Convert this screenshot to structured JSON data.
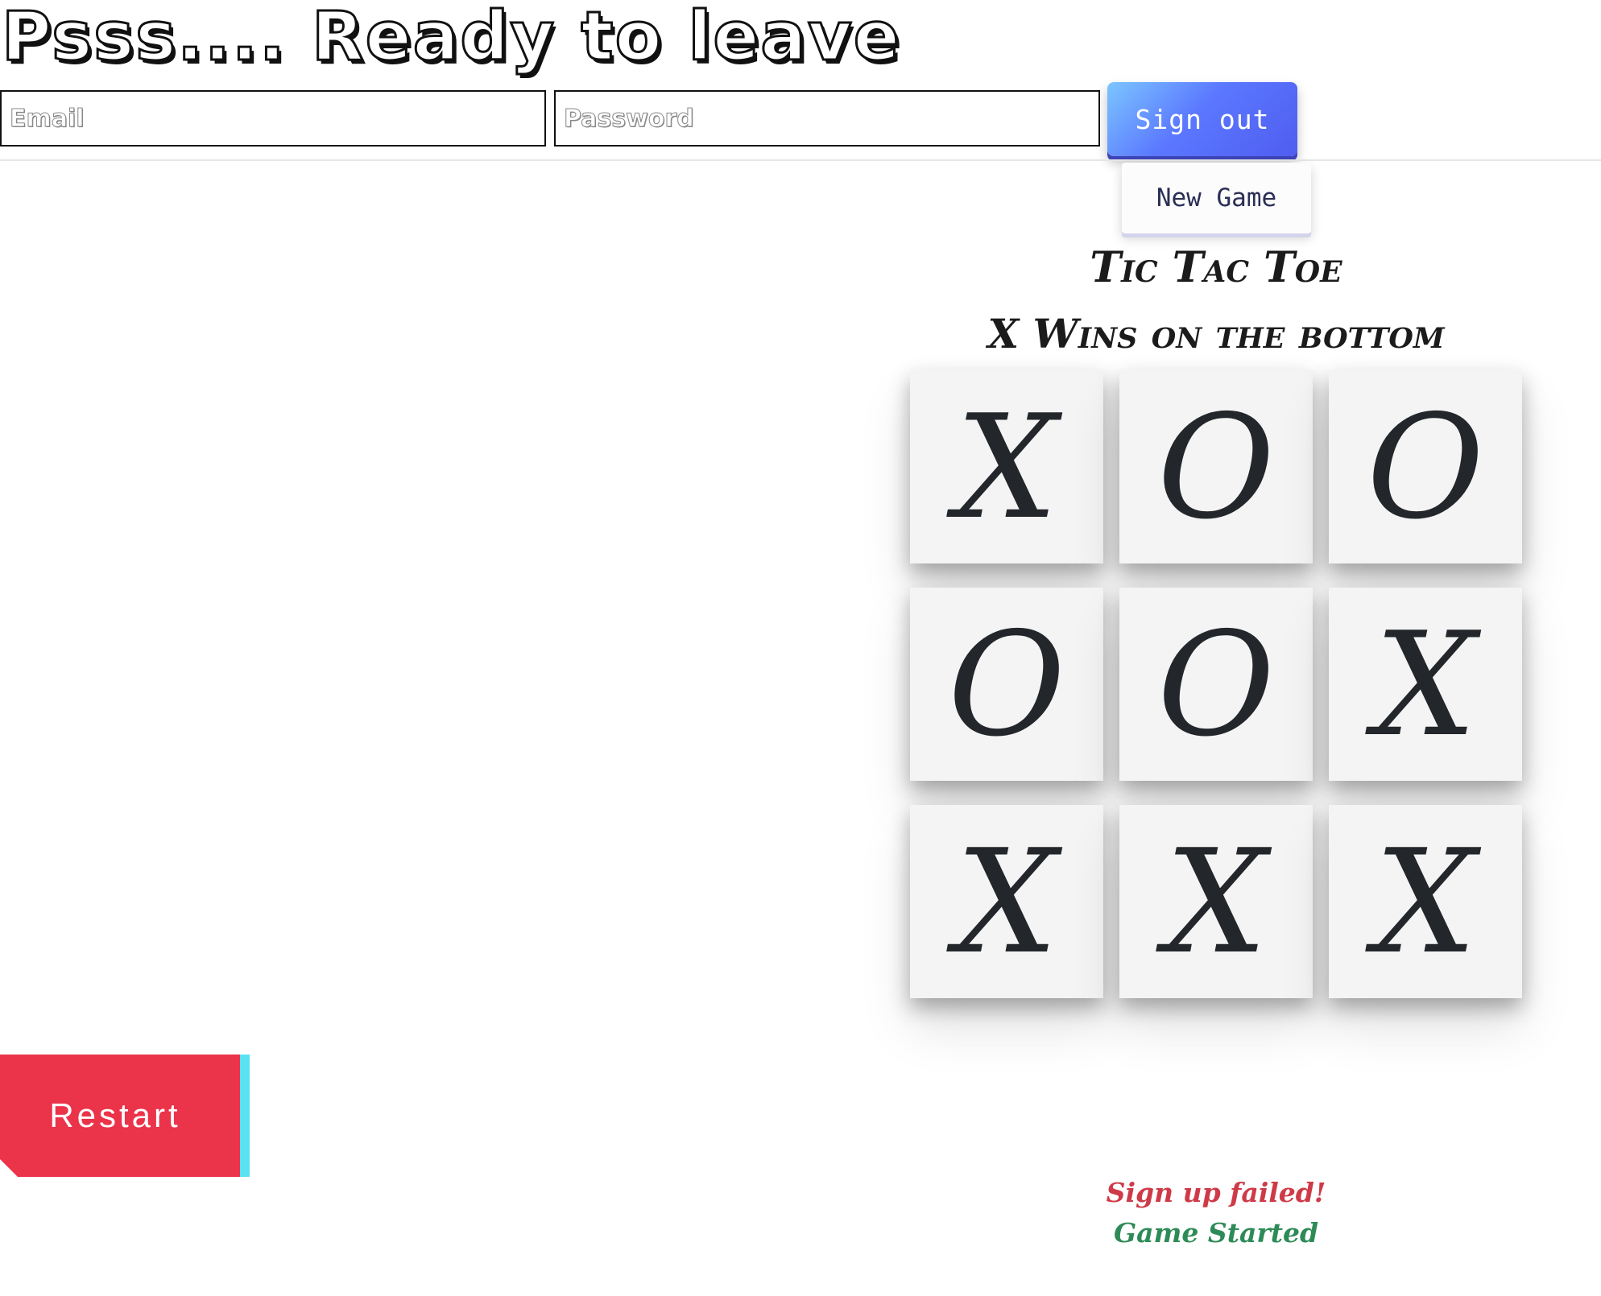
{
  "header": {
    "title": "Psss.... Ready to leave",
    "email_placeholder": "Email",
    "password_placeholder": "Password",
    "sign_out_label": "Sign out"
  },
  "game": {
    "new_game_label": "New Game",
    "title": "Tic Tac Toe",
    "status": "X Wins on the bottom",
    "board": [
      "X",
      "O",
      "O",
      "O",
      "O",
      "X",
      "X",
      "X",
      "X"
    ],
    "restart_label": "Restart"
  },
  "messages": {
    "signup_failed": "Sign up failed!",
    "game_started": "Game Started"
  },
  "colors": {
    "restart_bg": "#eb3349",
    "restart_accent": "#5ae2f2",
    "signout_gradient_start": "#7cc6ff",
    "signout_gradient_end": "#4f5df0",
    "error_text": "#cf3a48",
    "success_text": "#2e8b57"
  }
}
